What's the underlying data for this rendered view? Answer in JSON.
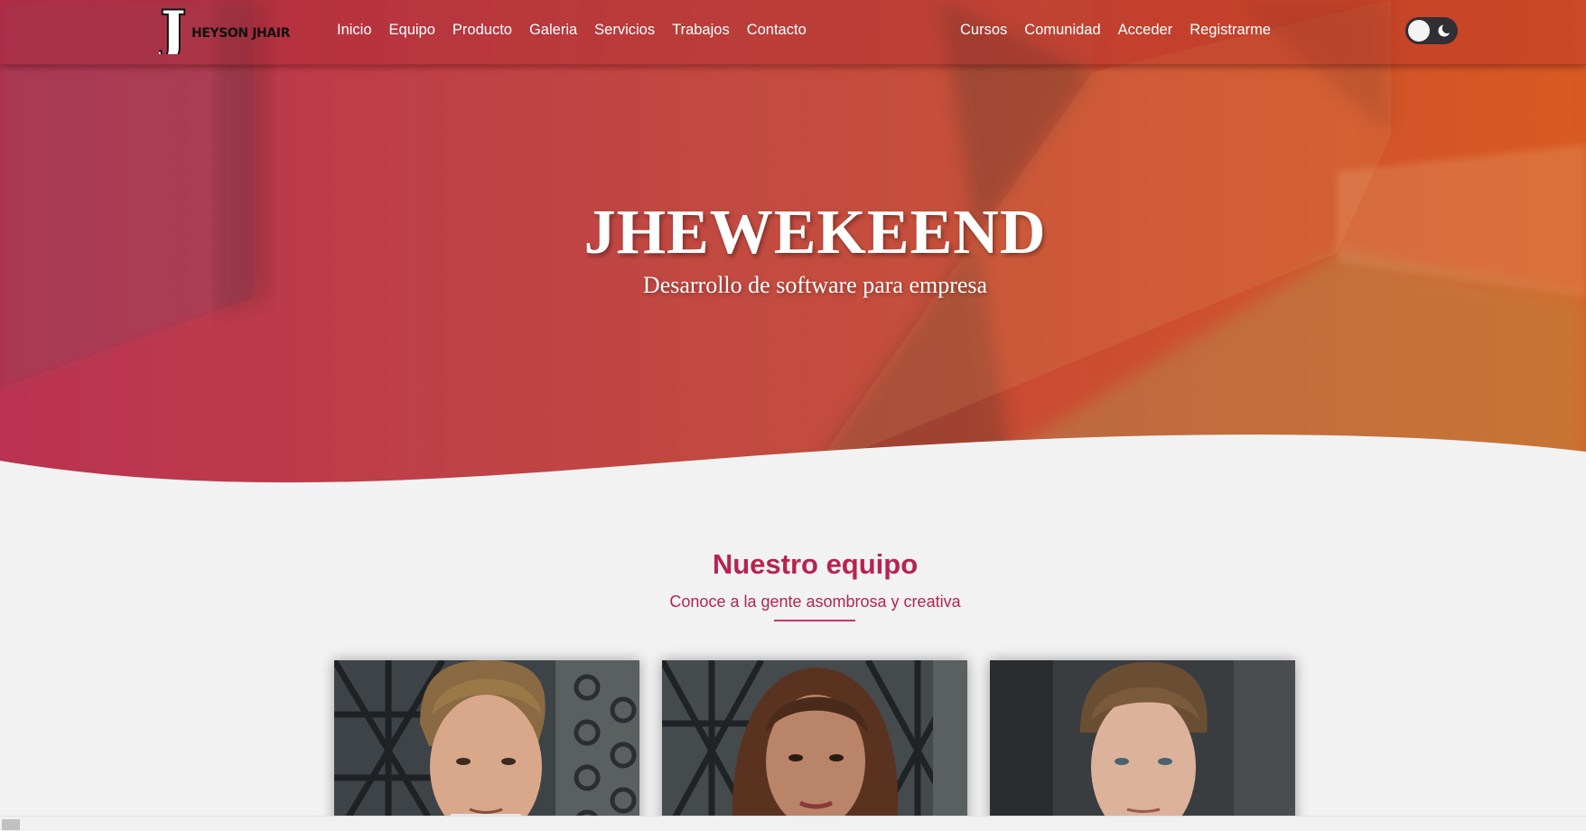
{
  "brand": {
    "logo_initial": "J",
    "logo_text": "HEYSON JHAIR"
  },
  "nav": {
    "left": [
      "Inicio",
      "Equipo",
      "Producto",
      "Galeria",
      "Servicios",
      "Trabajos",
      "Contacto"
    ],
    "right": [
      "Cursos",
      "Comunidad",
      "Acceder",
      "Registrarme"
    ]
  },
  "theme_toggle": {
    "icon": "moon-icon",
    "state": "light"
  },
  "hero": {
    "title": "JHEWEKEEND",
    "subtitle": "Desarrollo de software para empresa"
  },
  "team": {
    "title": "Nuestro equipo",
    "subtitle": "Conoce a la gente asombrosa y creativa",
    "members": [
      {
        "photo": "man-portrait-slicked-hair"
      },
      {
        "photo": "woman-portrait-long-hair"
      },
      {
        "photo": "man-portrait-short-hair"
      }
    ]
  },
  "colors": {
    "accent": "#b7234f",
    "nav_text": "#ffffff",
    "page_background": "#f2f2f2",
    "toggle_background": "#2f2f35"
  }
}
